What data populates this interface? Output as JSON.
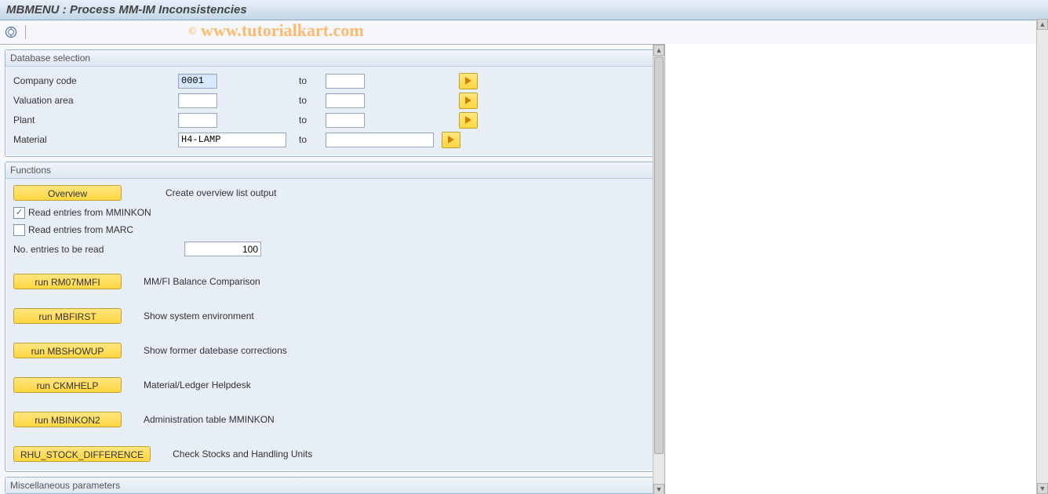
{
  "title": "MBMENU : Process MM-IM Inconsistencies",
  "watermark": "www.tutorialkart.com",
  "panels": {
    "db": {
      "title": "Database selection",
      "rows": {
        "company_code": {
          "label": "Company code",
          "from": "0001",
          "to_label": "to",
          "to": ""
        },
        "valuation": {
          "label": "Valuation area",
          "from": "",
          "to_label": "to",
          "to": ""
        },
        "plant": {
          "label": "Plant",
          "from": "",
          "to_label": "to",
          "to": ""
        },
        "material": {
          "label": "Material",
          "from": "H4-LAMP",
          "to_label": "to",
          "to": ""
        }
      }
    },
    "func": {
      "title": "Functions",
      "overview_btn": "Overview",
      "overview_desc": "Create overview list output",
      "chk_mm": "Read entries from MMINKON",
      "chk_marc": "Read entries from MARC",
      "entries_label": "No. entries to be read",
      "entries_value": "100",
      "items": [
        {
          "btn": "run RM07MMFI",
          "desc": "MM/FI Balance Comparison"
        },
        {
          "btn": "run MBFIRST",
          "desc": "Show system environment"
        },
        {
          "btn": "run MBSHOWUP",
          "desc": "Show former datebase corrections"
        },
        {
          "btn": "run CKMHELP",
          "desc": "Material/Ledger Helpdesk"
        },
        {
          "btn": "run MBINKON2",
          "desc": "Administration table MMINKON"
        },
        {
          "btn": "RHU_STOCK_DIFFERENCE",
          "desc": "Check Stocks and Handling Units"
        }
      ]
    },
    "misc": {
      "title": "Miscellaneous parameters"
    }
  }
}
